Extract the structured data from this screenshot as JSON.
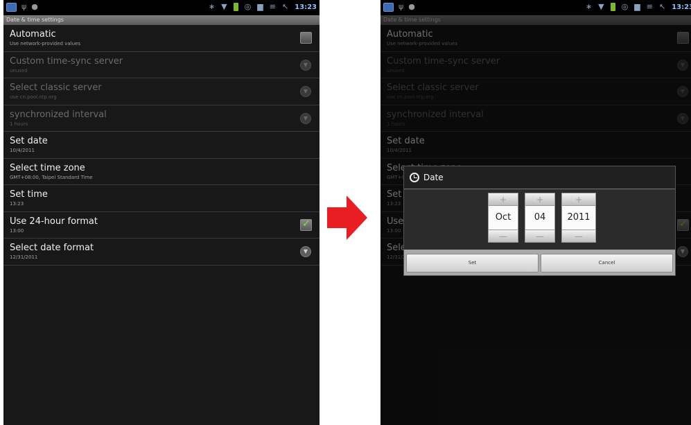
{
  "status_bar": {
    "time": "13:23"
  },
  "screen_title": "Date & time settings",
  "preferences": [
    {
      "title": "Automatic",
      "summary": "Use network-provided values",
      "widget": "checkbox",
      "checked": false,
      "enabled": true
    },
    {
      "title": "Custom time-sync server",
      "summary": "unused",
      "widget": "chevron",
      "enabled": false
    },
    {
      "title": "Select classic server",
      "summary": "use cn.pool.ntp.org",
      "widget": "chevron",
      "enabled": false
    },
    {
      "title": "synchronized interval",
      "summary": "1 hours",
      "widget": "chevron",
      "enabled": false
    },
    {
      "title": "Set date",
      "summary": "10/4/2011",
      "widget": "none",
      "enabled": true
    },
    {
      "title": "Select time zone",
      "summary": "GMT+08:00, Taipei Standard Time",
      "widget": "none",
      "enabled": true
    },
    {
      "title": "Set time",
      "summary": "13:23",
      "widget": "none",
      "enabled": true
    },
    {
      "title": "Use 24-hour format",
      "summary": "13:00",
      "widget": "checkbox",
      "checked": true,
      "enabled": true
    },
    {
      "title": "Select date format",
      "summary": "12/31/2011",
      "widget": "chevron",
      "enabled": true
    }
  ],
  "dialog": {
    "title": "Date",
    "month": "Oct",
    "day": "04",
    "year": "2011",
    "increment": "+",
    "decrement": "—",
    "set_label": "Set",
    "cancel_label": "Cancel"
  },
  "colors": {
    "arrow": "#e81e22",
    "status_time": "#8ec0ff",
    "check": "#8ee03a"
  },
  "icons": [
    "usb-icon",
    "android-icon",
    "bluetooth-icon",
    "wifi-icon",
    "battery-icon",
    "alarm-icon",
    "sd-card-icon",
    "signal-icon",
    "clock-icon",
    "chevron-down-icon",
    "checkmark-icon"
  ]
}
